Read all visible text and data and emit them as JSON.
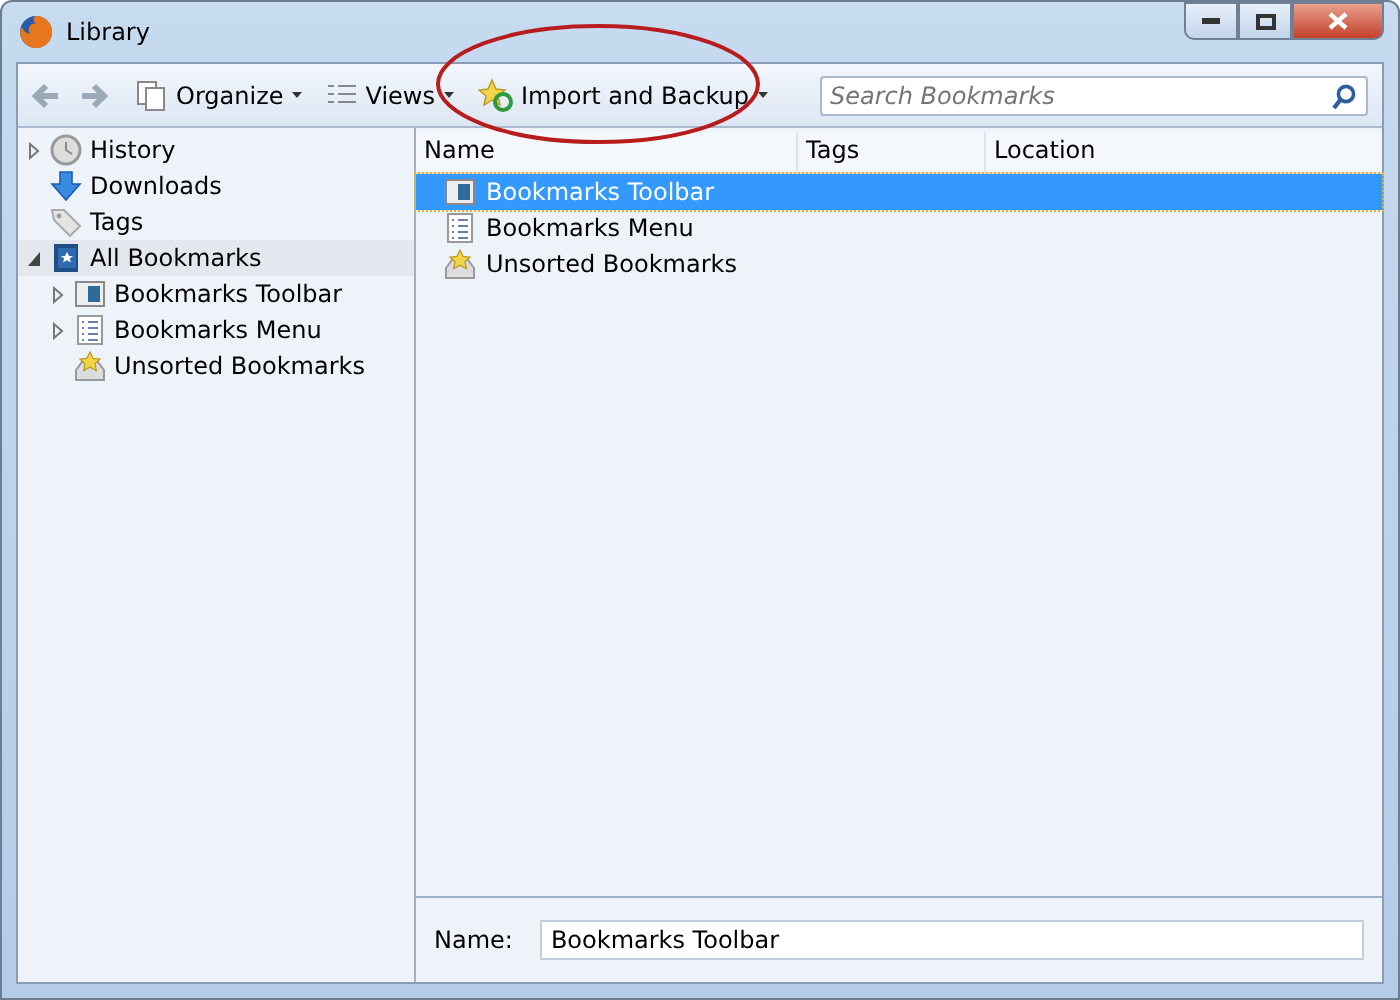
{
  "window": {
    "title": "Library"
  },
  "toolbar": {
    "buttons": [
      {
        "kind": "organize",
        "label": "Organize"
      },
      {
        "kind": "views",
        "label": "Views"
      },
      {
        "kind": "import",
        "label": "Import and Backup"
      }
    ],
    "search": {
      "placeholder": "Search Bookmarks"
    }
  },
  "sidebar": {
    "items": [
      {
        "kind": "history",
        "label": "History",
        "expanded": false,
        "selected": false
      },
      {
        "kind": "downloads",
        "label": "Downloads",
        "selected": false
      },
      {
        "kind": "tags",
        "label": "Tags",
        "selected": false
      },
      {
        "kind": "all",
        "label": "All Bookmarks",
        "expanded": true,
        "selected": true,
        "children": [
          {
            "kind": "toolbar",
            "label": "Bookmarks Toolbar",
            "expanded": false,
            "selected": false
          },
          {
            "kind": "menu",
            "label": "Bookmarks Menu",
            "expanded": false,
            "selected": false
          },
          {
            "kind": "unsorted",
            "label": "Unsorted Bookmarks",
            "selected": false
          }
        ]
      }
    ]
  },
  "table": {
    "columns": [
      "Name",
      "Tags",
      "Location"
    ],
    "rows": [
      {
        "kind": "toolbar",
        "name": "Bookmarks Toolbar",
        "selected": true
      },
      {
        "kind": "menu",
        "name": "Bookmarks Menu",
        "selected": false
      },
      {
        "kind": "unsorted",
        "name": "Unsorted Bookmarks",
        "selected": false
      }
    ]
  },
  "details": {
    "label": "Name:",
    "value": "Bookmarks Toolbar"
  }
}
